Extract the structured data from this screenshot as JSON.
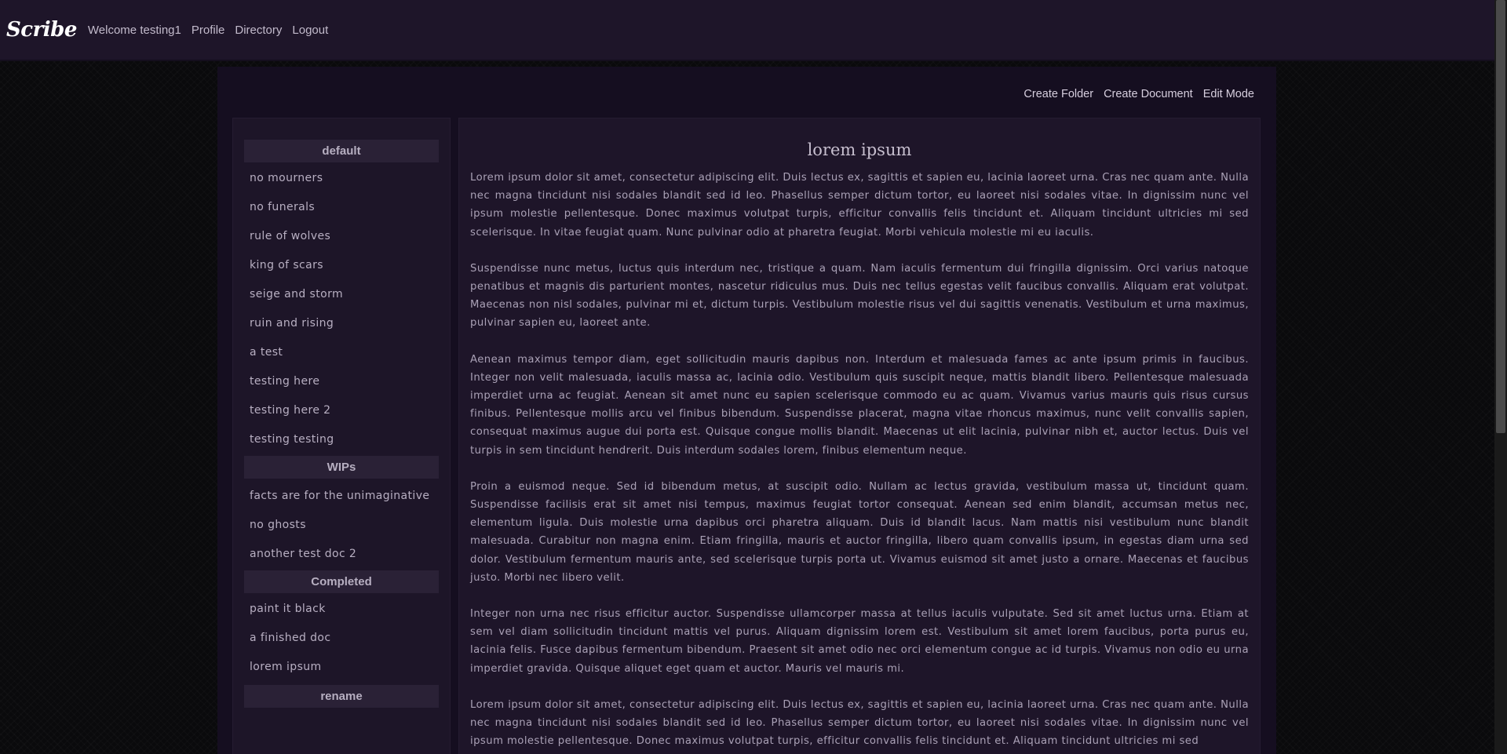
{
  "nav": {
    "brand": "Scribe",
    "welcome": "Welcome testing1",
    "links": [
      "Profile",
      "Directory",
      "Logout"
    ]
  },
  "actions": [
    "Create Folder",
    "Create Document",
    "Edit Mode"
  ],
  "sidebar": {
    "folders": [
      {
        "name": "default",
        "documents": [
          "no mourners",
          "no funerals",
          "rule of wolves",
          "king of scars",
          "seige and storm",
          "ruin and rising",
          "a test",
          "testing here",
          "testing here 2",
          "testing testing"
        ]
      },
      {
        "name": "WIPs",
        "documents": [
          "facts are for the unimaginative",
          "no ghosts",
          "another test doc 2"
        ]
      },
      {
        "name": "Completed",
        "documents": [
          "paint it black",
          "a finished doc",
          "lorem ipsum"
        ]
      },
      {
        "name": "rename",
        "documents": []
      }
    ]
  },
  "document": {
    "title": "lorem ipsum",
    "paragraphs": [
      "Lorem ipsum dolor sit amet, consectetur adipiscing elit. Duis lectus ex, sagittis et sapien eu, lacinia laoreet urna. Cras nec quam ante. Nulla nec magna tincidunt nisi sodales blandit sed id leo. Phasellus semper dictum tortor, eu laoreet nisi sodales vitae. In dignissim nunc vel ipsum molestie pellentesque. Donec maximus volutpat turpis, efficitur convallis felis tincidunt et. Aliquam tincidunt ultricies mi sed scelerisque. In vitae feugiat quam. Nunc pulvinar odio at pharetra feugiat. Morbi vehicula molestie mi eu iaculis.",
      "Suspendisse nunc metus, luctus quis interdum nec, tristique a quam. Nam iaculis fermentum dui fringilla dignissim. Orci varius natoque penatibus et magnis dis parturient montes, nascetur ridiculus mus. Duis nec tellus egestas velit faucibus convallis. Aliquam erat volutpat. Maecenas non nisl sodales, pulvinar mi et, dictum turpis. Vestibulum molestie risus vel dui sagittis venenatis. Vestibulum et urna maximus, pulvinar sapien eu, laoreet ante.",
      "Aenean maximus tempor diam, eget sollicitudin mauris dapibus non. Interdum et malesuada fames ac ante ipsum primis in faucibus. Integer non velit malesuada, iaculis massa ac, lacinia odio. Vestibulum quis suscipit neque, mattis blandit libero. Pellentesque malesuada imperdiet urna ac feugiat. Aenean sit amet nunc eu sapien scelerisque commodo eu ac quam. Vivamus varius mauris quis risus cursus finibus. Pellentesque mollis arcu vel finibus bibendum. Suspendisse placerat, magna vitae rhoncus maximus, nunc velit convallis sapien, consequat maximus augue dui porta est. Quisque congue mollis blandit. Maecenas ut elit lacinia, pulvinar nibh et, auctor lectus. Duis vel turpis in sem tincidunt hendrerit. Duis interdum sodales lorem, finibus elementum neque.",
      "Proin a euismod neque. Sed id bibendum metus, at suscipit odio. Nullam ac lectus gravida, vestibulum massa ut, tincidunt quam. Suspendisse facilisis erat sit amet nisi tempus, maximus feugiat tortor consequat. Aenean sed enim blandit, accumsan metus nec, elementum ligula. Duis molestie urna dapibus orci pharetra aliquam. Duis id blandit lacus. Nam mattis nisi vestibulum nunc blandit malesuada. Curabitur non magna enim. Etiam fringilla, mauris et auctor fringilla, libero quam convallis ipsum, in egestas diam urna sed dolor. Vestibulum fermentum mauris ante, sed scelerisque turpis porta ut. Vivamus euismod sit amet justo a ornare. Maecenas et faucibus justo. Morbi nec libero velit.",
      "Integer non urna nec risus efficitur auctor. Suspendisse ullamcorper massa at tellus iaculis vulputate. Sed sit amet luctus urna. Etiam at sem vel diam sollicitudin tincidunt mattis vel purus. Aliquam dignissim lorem est. Vestibulum sit amet lorem faucibus, porta purus eu, lacinia felis. Fusce dapibus fermentum bibendum. Praesent sit amet odio nec orci elementum congue ac id turpis. Vivamus non odio eu urna imperdiet gravida. Quisque aliquet eget quam et auctor. Mauris vel mauris mi.",
      "Lorem ipsum dolor sit amet, consectetur adipiscing elit. Duis lectus ex, sagittis et sapien eu, lacinia laoreet urna. Cras nec quam ante. Nulla nec magna tincidunt nisi sodales blandit sed id leo. Phasellus semper dictum tortor, eu laoreet nisi sodales vitae. In dignissim nunc vel ipsum molestie pellentesque. Donec maximus volutpat turpis, efficitur convallis felis tincidunt et. Aliquam tincidunt ultricies mi sed"
    ]
  }
}
